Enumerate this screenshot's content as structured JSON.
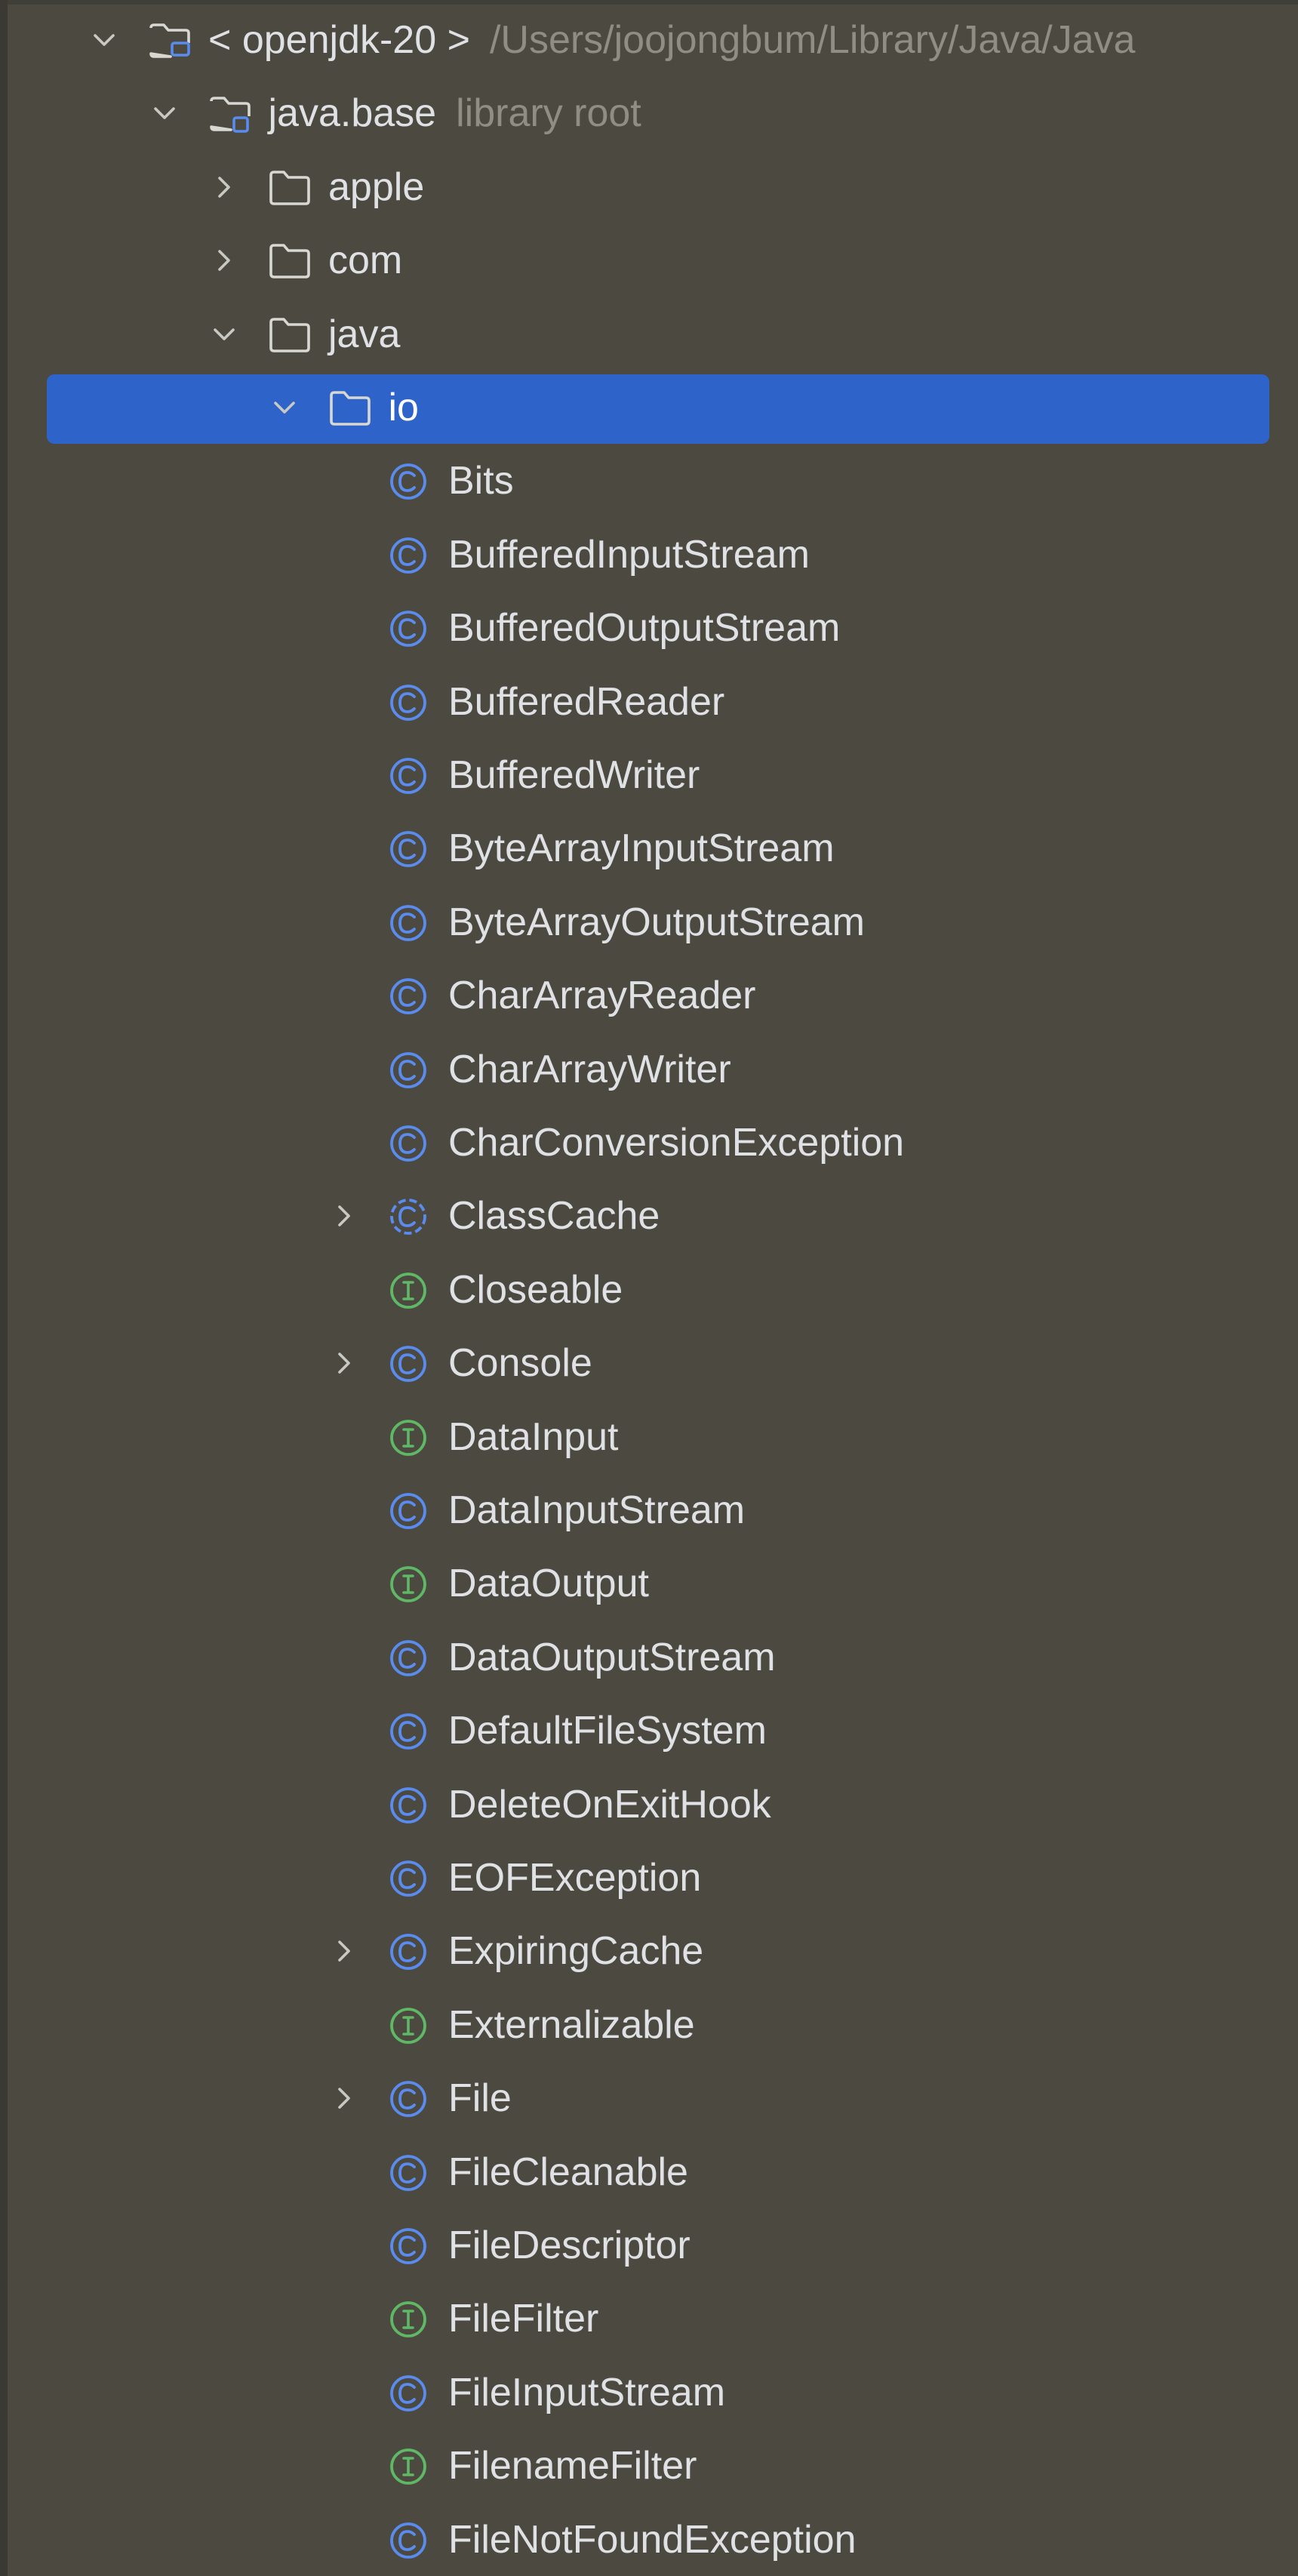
{
  "colors": {
    "background": "#4c4a40",
    "selection": "#2e63c9",
    "text": "#dfe1e5",
    "muted_text": "#8f8d84",
    "class_icon": "#5a8cf0",
    "interface_icon": "#5fb865"
  },
  "tree": {
    "rows": [
      {
        "depth": 0,
        "chevron": "chevron-down-icon",
        "icon": "module-folder-icon",
        "label": "< openjdk-20 >",
        "hint": "/Users/joojongbum/Library/Java/Java"
      },
      {
        "depth": 1,
        "chevron": "chevron-down-icon",
        "icon": "library-folder-icon",
        "label": "java.base",
        "hint": "library root"
      },
      {
        "depth": 2,
        "chevron": "chevron-right-icon",
        "icon": "folder-icon",
        "label": "apple"
      },
      {
        "depth": 2,
        "chevron": "chevron-right-icon",
        "icon": "folder-icon",
        "label": "com"
      },
      {
        "depth": 2,
        "chevron": "chevron-down-icon",
        "icon": "folder-icon",
        "label": "java"
      },
      {
        "depth": 3,
        "chevron": "chevron-down-icon",
        "icon": "folder-icon",
        "label": "io",
        "selected": true
      },
      {
        "depth": 4,
        "icon": "class-icon",
        "label": "Bits"
      },
      {
        "depth": 4,
        "icon": "class-icon",
        "label": "BufferedInputStream"
      },
      {
        "depth": 4,
        "icon": "class-icon",
        "label": "BufferedOutputStream"
      },
      {
        "depth": 4,
        "icon": "class-icon",
        "label": "BufferedReader"
      },
      {
        "depth": 4,
        "icon": "class-icon",
        "label": "BufferedWriter"
      },
      {
        "depth": 4,
        "icon": "class-icon",
        "label": "ByteArrayInputStream"
      },
      {
        "depth": 4,
        "icon": "class-icon",
        "label": "ByteArrayOutputStream"
      },
      {
        "depth": 4,
        "icon": "class-icon",
        "label": "CharArrayReader"
      },
      {
        "depth": 4,
        "icon": "class-icon",
        "label": "CharArrayWriter"
      },
      {
        "depth": 4,
        "icon": "class-icon",
        "label": "CharConversionException"
      },
      {
        "depth": 4,
        "chevron": "chevron-right-icon",
        "icon": "abstract-class-icon",
        "label": "ClassCache"
      },
      {
        "depth": 4,
        "icon": "interface-icon",
        "label": "Closeable"
      },
      {
        "depth": 4,
        "chevron": "chevron-right-icon",
        "icon": "class-icon",
        "label": "Console"
      },
      {
        "depth": 4,
        "icon": "interface-icon",
        "label": "DataInput"
      },
      {
        "depth": 4,
        "icon": "class-icon",
        "label": "DataInputStream"
      },
      {
        "depth": 4,
        "icon": "interface-icon",
        "label": "DataOutput"
      },
      {
        "depth": 4,
        "icon": "class-icon",
        "label": "DataOutputStream"
      },
      {
        "depth": 4,
        "icon": "class-icon",
        "label": "DefaultFileSystem"
      },
      {
        "depth": 4,
        "icon": "class-icon",
        "label": "DeleteOnExitHook"
      },
      {
        "depth": 4,
        "icon": "class-icon",
        "label": "EOFException"
      },
      {
        "depth": 4,
        "chevron": "chevron-right-icon",
        "icon": "class-icon",
        "label": "ExpiringCache"
      },
      {
        "depth": 4,
        "icon": "interface-icon",
        "label": "Externalizable"
      },
      {
        "depth": 4,
        "chevron": "chevron-right-icon",
        "icon": "class-icon",
        "label": "File"
      },
      {
        "depth": 4,
        "icon": "class-icon",
        "label": "FileCleanable"
      },
      {
        "depth": 4,
        "icon": "class-icon",
        "label": "FileDescriptor"
      },
      {
        "depth": 4,
        "icon": "interface-icon",
        "label": "FileFilter"
      },
      {
        "depth": 4,
        "icon": "class-icon",
        "label": "FileInputStream"
      },
      {
        "depth": 4,
        "icon": "interface-icon",
        "label": "FilenameFilter"
      },
      {
        "depth": 4,
        "icon": "class-icon",
        "label": "FileNotFoundException"
      }
    ]
  }
}
